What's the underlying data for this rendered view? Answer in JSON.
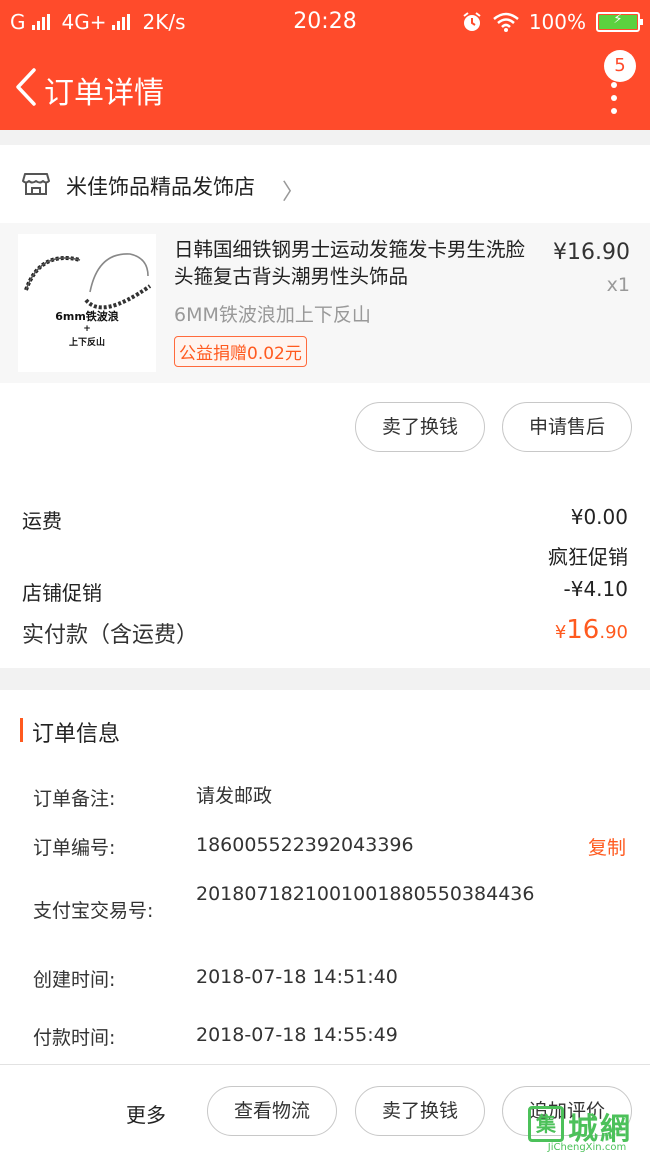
{
  "status_bar": {
    "carrier": "G",
    "network": "4G+",
    "speed": "2K/s",
    "time": "20:28",
    "battery": "100%",
    "battery_level": 1.0
  },
  "nav": {
    "title": "订单详情",
    "badge_count": "5"
  },
  "store": {
    "name": "米佳饰品精品发饰店"
  },
  "product": {
    "title": "日韩国细铁钢男士运动发箍发卡男生洗脸头箍复古背头潮男性头饰品",
    "price": "¥16.90",
    "qty": "x1",
    "sku": "6MM铁波浪加上下反山",
    "tag": "公益捐赠0.02元",
    "image_caption": "6mm铁波浪",
    "image_plus": "+",
    "image_caption2": "上下反山"
  },
  "item_actions": {
    "sell_label": "卖了换钱",
    "after_sale_label": "申请售后"
  },
  "fees": {
    "shipping_label": "运费",
    "shipping_value": "¥0.00",
    "promo_name": "疯狂促销",
    "store_promo_label": "店铺促销",
    "store_promo_value": "-¥4.10",
    "total_label": "实付款（含运费）",
    "total_symbol": "¥",
    "total_int": "16",
    "total_dec": ".90"
  },
  "order_info": {
    "heading": "订单信息",
    "note_label": "订单备注:",
    "note_value": "请发邮政",
    "order_no_label": "订单编号:",
    "order_no_value": "186005522392043396",
    "copy_label": "复制",
    "alipay_label": "支付宝交易号:",
    "alipay_value": "2018071821001001880550384436",
    "created_label": "创建时间:",
    "created_value": "2018-07-18 14:51:40",
    "paid_label": "付款时间:",
    "paid_value": "2018-07-18 14:55:49"
  },
  "bottom_bar": {
    "more_label": "更多",
    "logistics_label": "查看物流",
    "sell_label": "卖了换钱",
    "review_label": "追加评价"
  },
  "watermark": {
    "glyph": "集",
    "text": "城網",
    "url": "JiChengXin.com"
  },
  "colors": {
    "brand": "#ff4b2b",
    "accent": "#ff5a1f"
  }
}
